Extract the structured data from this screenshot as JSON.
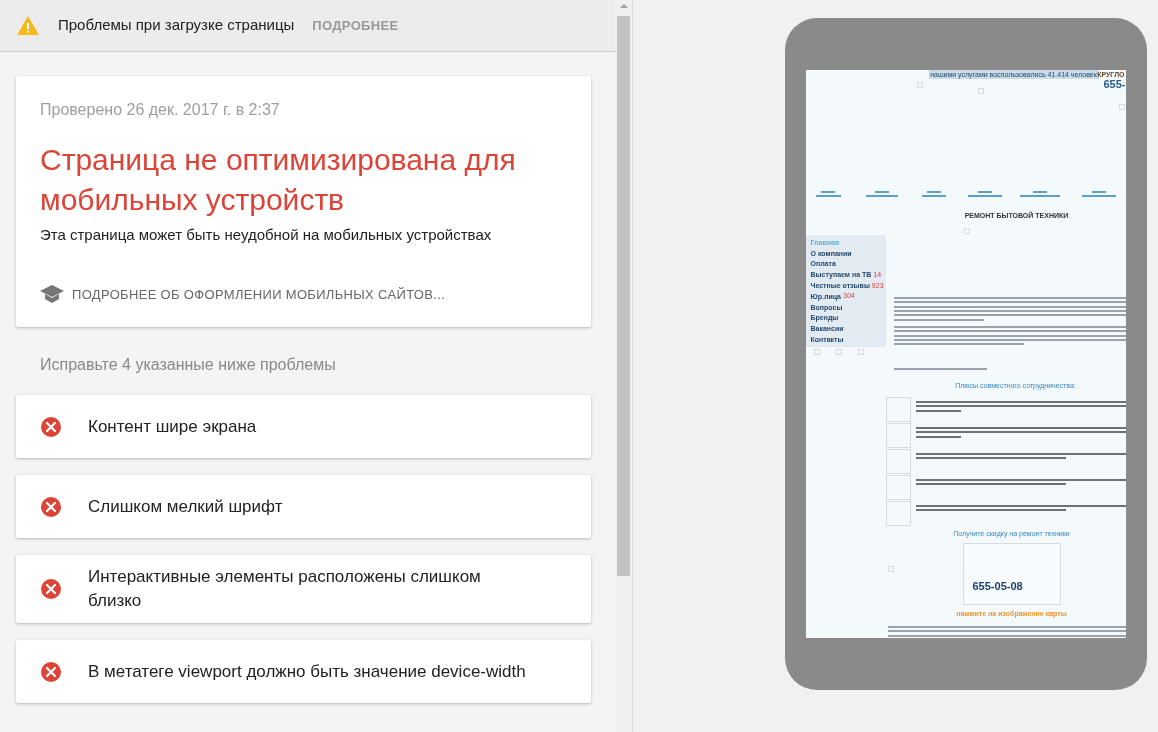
{
  "warning_bar": {
    "message": "Проблемы при загрузке страницы",
    "action": "ПОДРОБНЕЕ"
  },
  "result_card": {
    "checked_at": "Проверено 26 дек. 2017 г. в 2:37",
    "verdict": "Страница не оптимизирована для мобильных устройств",
    "description": "Эта страница может быть неудобной на мобильных устройствах",
    "link": "ПОДРОБНЕЕ ОБ ОФОРМЛЕНИИ МОБИЛЬНЫХ САЙТОВ..."
  },
  "issues": {
    "heading": "Исправьте 4 указанные ниже проблемы",
    "items": [
      {
        "text": "Контент шире экрана"
      },
      {
        "text": "Слишком мелкий шрифт"
      },
      {
        "text": "Интерактивные элементы расположены слишком близко"
      },
      {
        "text": "В метатеге viewport должно быть значение device-width"
      }
    ]
  },
  "preview": {
    "counter": "нашими услугами воспользовались 41.414 человек",
    "corner_label": "КРУГЛО",
    "corner_phone": "655-",
    "heading": "РЕМОНТ БЫТОВОЙ ТЕХНИКИ",
    "menu": [
      {
        "label": "Главная",
        "selected": true
      },
      {
        "label": "О компании",
        "selected": false
      },
      {
        "label": "Оплата",
        "selected": false
      },
      {
        "label": "Выступаем на ТВ",
        "badge": "14",
        "selected": false
      },
      {
        "label": "Честные отзывы",
        "badge": "923",
        "selected": false
      },
      {
        "label": "Юр.лица",
        "badge": "304",
        "selected": false
      },
      {
        "label": "Вопросы",
        "selected": false
      },
      {
        "label": "Бренды",
        "selected": false
      },
      {
        "label": "Вакансии",
        "selected": false
      },
      {
        "label": "Контакты",
        "selected": false
      }
    ],
    "benefits_heading": "Плюсы совместного сотрудничества:",
    "discount_heading": "Получите скидку на ремонт техники",
    "map_phone": "655-05-08",
    "map_hint": "нажмите на изображение карты"
  }
}
